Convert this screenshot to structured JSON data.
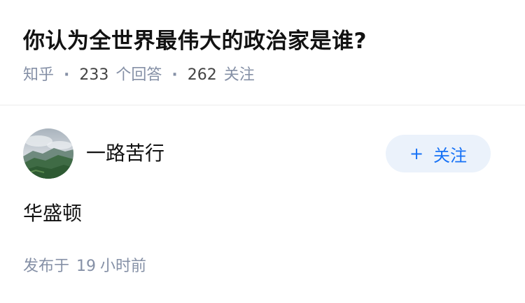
{
  "question": {
    "title": "你认为全世界最伟大的政治家是谁?",
    "source": "知乎",
    "answer_count": "233",
    "answer_unit": "个回答",
    "follower_count": "262",
    "follower_unit": "关注",
    "separator": "·"
  },
  "answer": {
    "author_name": "一路苦行",
    "avatar": "avatar-landscape-icon",
    "follow_button": {
      "plus": "+",
      "label": "关注"
    },
    "content": "华盛顿",
    "published_prefix": "发布于",
    "published_value": "19",
    "published_unit": "小时前"
  },
  "colors": {
    "title": "#121212",
    "meta": "#8590a6",
    "accent": "#1772f6",
    "button_bg": "#ebf2fb",
    "divider": "#ebebeb"
  }
}
